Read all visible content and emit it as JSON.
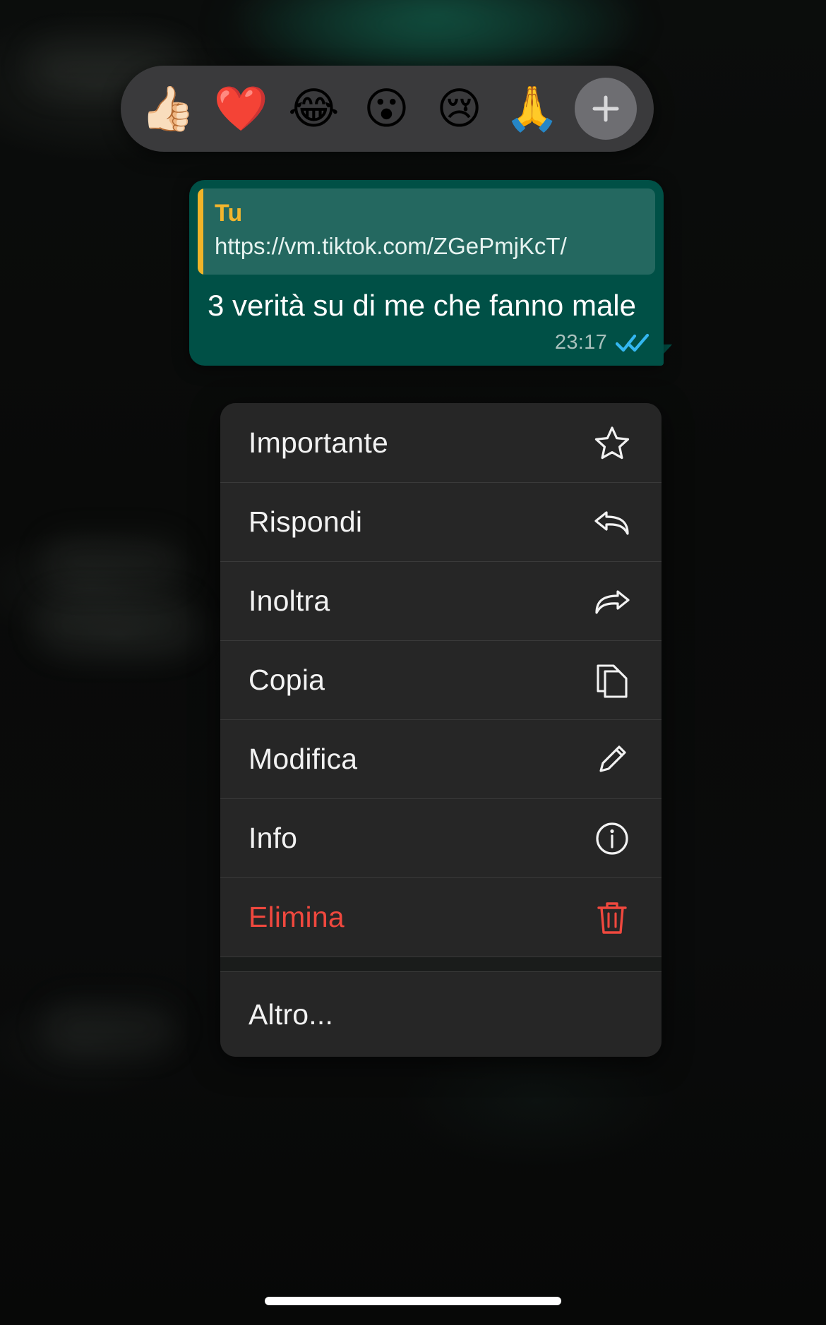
{
  "reaction_bar": {
    "reactions": [
      {
        "name": "thumbs-up-reaction",
        "glyph": "👍🏻"
      },
      {
        "name": "red-heart-reaction",
        "glyph": "❤️"
      },
      {
        "name": "tears-of-joy-reaction",
        "glyph": "😂"
      },
      {
        "name": "open-mouth-reaction",
        "glyph": "😮"
      },
      {
        "name": "crying-face-reaction",
        "glyph": "😢"
      },
      {
        "name": "folded-hands-reaction",
        "glyph": "🙏"
      }
    ],
    "add_reaction_label": "+"
  },
  "message": {
    "quote": {
      "author": "Tu",
      "text": "https://vm.tiktok.com/ZGePmjKcT/"
    },
    "body": "3 verità su di me che fanno male",
    "time": "23:17",
    "status": "read-double-check"
  },
  "context_menu": {
    "items": [
      {
        "label": "Importante",
        "icon": "star-icon"
      },
      {
        "label": "Rispondi",
        "icon": "reply-arrow-icon"
      },
      {
        "label": "Inoltra",
        "icon": "forward-arrow-icon"
      },
      {
        "label": "Copia",
        "icon": "copy-icon"
      },
      {
        "label": "Modifica",
        "icon": "pencil-icon"
      },
      {
        "label": "Info",
        "icon": "info-circle-icon"
      },
      {
        "label": "Elimina",
        "icon": "trash-icon",
        "danger": true
      }
    ],
    "more_label": "Altro..."
  },
  "colors": {
    "bubble_green": "#005046",
    "quote_accent": "#f0b429",
    "quote_author": "#f2b52d",
    "menu_background": "#262626",
    "danger_red": "#f0483e",
    "tick_blue": "#34b7f1",
    "reaction_bar_background": "#3a3a3c"
  }
}
